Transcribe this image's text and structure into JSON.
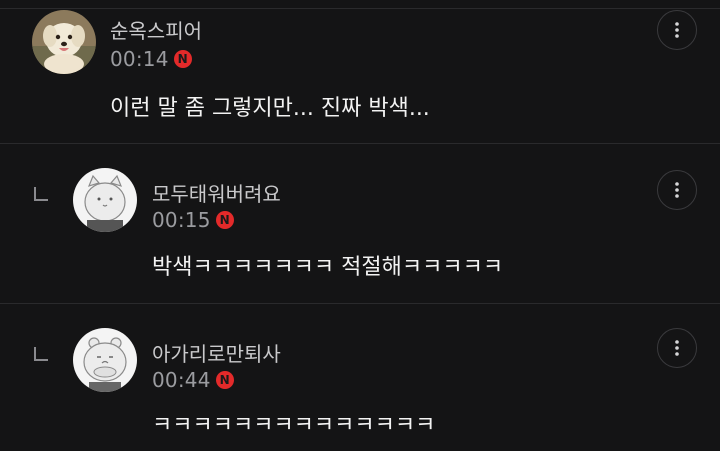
{
  "comments": [
    {
      "nickname": "순옥스피어",
      "time": "00:14",
      "badge": "N",
      "text": "이런 말 좀 그렇지만... 진짜 박색...",
      "avatar_icon": "dog-photo-avatar",
      "is_reply": false
    },
    {
      "nickname": "모두태워버려요",
      "time": "00:15",
      "badge": "N",
      "text": "박색ㅋㅋㅋㅋㅋㅋㅋ 적절해ㅋㅋㅋㅋㅋ",
      "avatar_icon": "cat-character-avatar",
      "is_reply": true
    },
    {
      "nickname": "아가리로만퇴사",
      "time": "00:44",
      "badge": "N",
      "text": "ㅋㅋㅋㅋㅋㅋㅋㅋㅋㅋㅋㅋㅋㅋ",
      "avatar_icon": "hamster-character-avatar",
      "is_reply": true
    }
  ],
  "colors": {
    "background": "#141415",
    "divider": "#2a2a2c",
    "new_badge": "#e32a2a",
    "nickname": "#c9c9cb",
    "time": "#9b9ca0",
    "text": "#f3f3f3"
  }
}
